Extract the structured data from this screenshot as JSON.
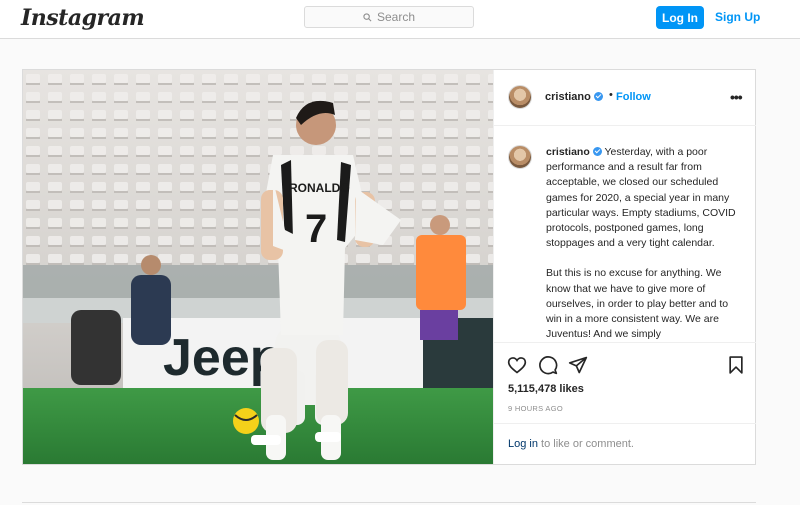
{
  "header": {
    "logo": "Instagram",
    "search_placeholder": "Search",
    "login_label": "Log In",
    "signup_label": "Sign Up"
  },
  "post": {
    "username": "cristiano",
    "separator": "•",
    "follow_label": "Follow",
    "more_label": "•••",
    "caption_paragraph_1": "Yesterday, with a poor performance and a result far from acceptable, we closed our scheduled games for 2020, a special year in many particular ways. Empty stadiums, COVID protocols, postponed games, long stoppages and a very tight calendar.",
    "caption_paragraph_2": "But this is no excuse for anything. We know that we have to give more of ourselves, in order to play better and to win in a more consistent way. We are Juventus! And we simply",
    "likes": "5,115,478 likes",
    "timestamp": "9 HOURS AGO",
    "login_prompt_link": "Log in",
    "login_prompt_rest": " to like or comment."
  },
  "photo": {
    "jersey_name": "RONALDO",
    "jersey_number": "7",
    "board_text": "Jeep"
  },
  "icons": [
    "search-icon",
    "heart-icon",
    "comment-icon",
    "share-icon",
    "bookmark-icon",
    "verified-icon"
  ],
  "colors": {
    "accent": "#0095f6",
    "verified": "#3897f0",
    "pitch": "#2f8a3a"
  }
}
